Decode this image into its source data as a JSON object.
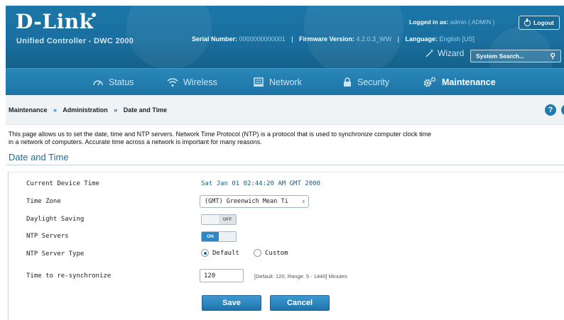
{
  "header": {
    "logo": "D-Link",
    "subtitle": "Unified Controller - DWC 2000",
    "serial_label": "Serial Number:",
    "serial_value": "0000000000001",
    "firmware_label": "Firmware Version:",
    "firmware_value": "4.2.0.3_WW",
    "language_label": "Language:",
    "language_value": "English [US]",
    "logged_label": "Logged in as:",
    "logged_value": "admin ( ADMIN )",
    "logout_label": "Logout",
    "wizard_label": "Wizard",
    "search_placeholder": "System Search..."
  },
  "nav": {
    "items": [
      {
        "label": "Status",
        "icon": "gauge-icon"
      },
      {
        "label": "Wireless",
        "icon": "wifi-icon"
      },
      {
        "label": "Network",
        "icon": "network-icon"
      },
      {
        "label": "Security",
        "icon": "lock-icon"
      },
      {
        "label": "Maintenance",
        "icon": "gears-icon",
        "active": true
      }
    ]
  },
  "breadcrumb": {
    "items": [
      "Maintenance",
      "Administration",
      "Date and Time"
    ],
    "separator": "»"
  },
  "description": {
    "line1": "This page allows us to set the date, time and NTP servers. Network Time Protocol (NTP) is a protocol that is used to synchronize computer clock time",
    "line2": "in a network of computers. Accurate time across a network is important for many reasons."
  },
  "section_title": "Date and Time",
  "form": {
    "current_time_label": "Current Device Time",
    "current_time_value": "Sat Jan 01 02:44:20 AM GMT 2000",
    "time_zone_label": "Time Zone",
    "time_zone_value": "(GMT) Greenwich Mean Ti",
    "daylight_label": "Daylight Saving",
    "daylight_state": "OFF",
    "ntp_label": "NTP Servers",
    "ntp_state": "ON",
    "ntp_type_label": "NTP Server Type",
    "ntp_type_default": "Default",
    "ntp_type_custom": "Custom",
    "ntp_type_selected": "Default",
    "resync_label": "Time to re-synchronize",
    "resync_value": "120",
    "resync_hint": "[Default: 120, Range: 5 - 1440] Minutes",
    "save_label": "Save",
    "cancel_label": "Cancel"
  },
  "colors": {
    "header_blue": "#1a6f9f",
    "nav_blue": "#1d74a6",
    "accent": "#2a87c8"
  }
}
